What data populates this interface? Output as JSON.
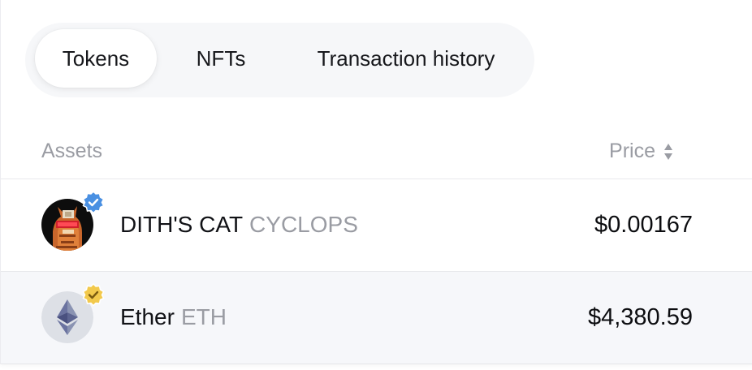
{
  "tabs": [
    {
      "label": "Tokens",
      "active": true
    },
    {
      "label": "NFTs",
      "active": false
    },
    {
      "label": "Transaction history",
      "active": false
    }
  ],
  "table": {
    "columns": {
      "assets": "Assets",
      "price": "Price"
    },
    "rows": [
      {
        "name": "DITH'S CAT",
        "symbol": "CYCLOPS",
        "price": "$0.00167",
        "badge": "verified-blue",
        "icon": "cat-avatar-icon"
      },
      {
        "name": "Ether",
        "symbol": "ETH",
        "price": "$4,380.59",
        "badge": "verified-gold",
        "icon": "ethereum-icon"
      }
    ]
  },
  "colors": {
    "accent_blue": "#4a90e2",
    "accent_gold": "#f2c94c",
    "muted_text": "#9a9ca3",
    "primary_text": "#111216"
  }
}
